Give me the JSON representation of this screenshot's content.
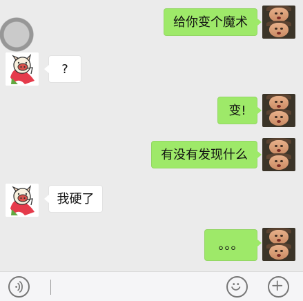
{
  "chat": {
    "messages": [
      {
        "sender": "me",
        "text": "给你变个魔术"
      },
      {
        "sender": "friend",
        "text": "?"
      },
      {
        "sender": "me",
        "text": "变!"
      },
      {
        "sender": "me",
        "text": "有没有发现什么"
      },
      {
        "sender": "friend",
        "text": "我硬了"
      },
      {
        "sender": "me",
        "text": "。。。"
      }
    ]
  },
  "icons": {
    "floating": "floating-ring-icon",
    "voice": "voice-icon",
    "emoji": "emoji-icon",
    "add": "plus-icon"
  },
  "colors": {
    "chat_background": "#ebebeb",
    "my_bubble": "#9ee969",
    "friend_bubble": "#ffffff",
    "toolbar": "#f5f5f7",
    "icon_gray": "#777777"
  }
}
